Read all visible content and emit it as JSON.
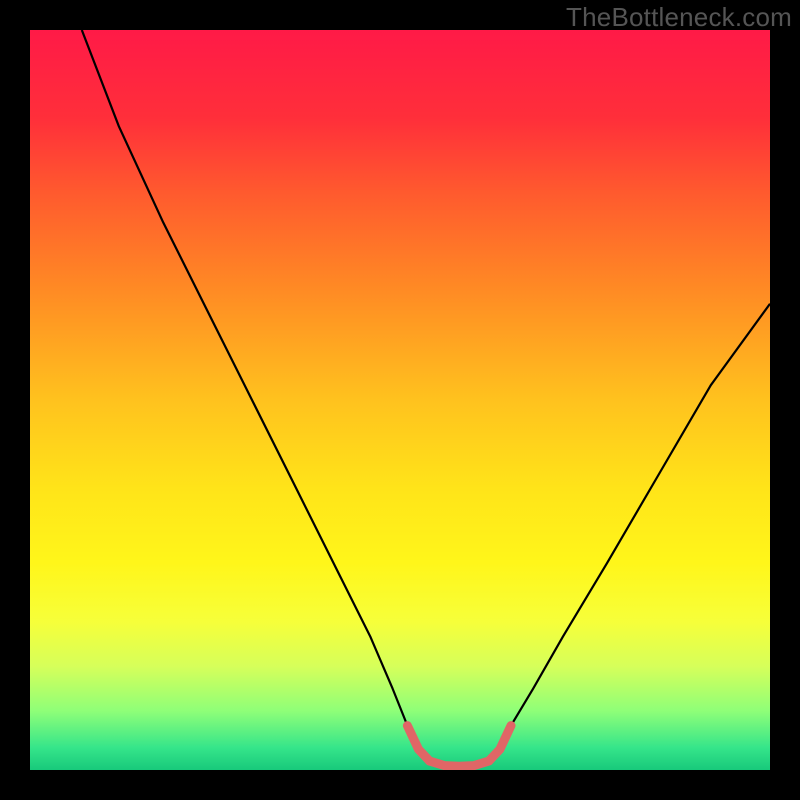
{
  "watermark": "TheBottleneck.com",
  "chart_data": {
    "type": "line",
    "title": "",
    "xlabel": "",
    "ylabel": "",
    "xlim": [
      0,
      100
    ],
    "ylim": [
      0,
      100
    ],
    "background_gradient": {
      "stops": [
        {
          "offset": 0.0,
          "color": "#ff1a47"
        },
        {
          "offset": 0.12,
          "color": "#ff2f3a"
        },
        {
          "offset": 0.22,
          "color": "#ff5a2e"
        },
        {
          "offset": 0.35,
          "color": "#ff8a24"
        },
        {
          "offset": 0.5,
          "color": "#ffc21e"
        },
        {
          "offset": 0.62,
          "color": "#ffe419"
        },
        {
          "offset": 0.72,
          "color": "#fff61a"
        },
        {
          "offset": 0.8,
          "color": "#f6ff3a"
        },
        {
          "offset": 0.86,
          "color": "#d6ff5a"
        },
        {
          "offset": 0.92,
          "color": "#8fff78"
        },
        {
          "offset": 0.97,
          "color": "#35e58a"
        },
        {
          "offset": 1.0,
          "color": "#18c97b"
        }
      ]
    },
    "curve": {
      "color": "#000000",
      "width": 2.2,
      "points": [
        {
          "x": 7.0,
          "y": 100.0
        },
        {
          "x": 12.0,
          "y": 87.0
        },
        {
          "x": 18.0,
          "y": 74.0
        },
        {
          "x": 24.0,
          "y": 62.0
        },
        {
          "x": 30.0,
          "y": 50.0
        },
        {
          "x": 36.0,
          "y": 38.0
        },
        {
          "x": 42.0,
          "y": 26.0
        },
        {
          "x": 46.0,
          "y": 18.0
        },
        {
          "x": 49.0,
          "y": 11.0
        },
        {
          "x": 51.0,
          "y": 6.0
        },
        {
          "x": 52.5,
          "y": 2.8
        },
        {
          "x": 54.0,
          "y": 1.2
        },
        {
          "x": 56.0,
          "y": 0.6
        },
        {
          "x": 58.0,
          "y": 0.5
        },
        {
          "x": 60.0,
          "y": 0.6
        },
        {
          "x": 62.0,
          "y": 1.2
        },
        {
          "x": 63.5,
          "y": 2.8
        },
        {
          "x": 65.0,
          "y": 6.0
        },
        {
          "x": 68.0,
          "y": 11.0
        },
        {
          "x": 72.0,
          "y": 18.0
        },
        {
          "x": 78.0,
          "y": 28.0
        },
        {
          "x": 85.0,
          "y": 40.0
        },
        {
          "x": 92.0,
          "y": 52.0
        },
        {
          "x": 100.0,
          "y": 63.0
        }
      ]
    },
    "highlight": {
      "color": "#e06666",
      "width": 9,
      "linecap": "round",
      "points": [
        {
          "x": 51.0,
          "y": 6.0
        },
        {
          "x": 52.5,
          "y": 2.8
        },
        {
          "x": 54.0,
          "y": 1.2
        },
        {
          "x": 56.0,
          "y": 0.6
        },
        {
          "x": 58.0,
          "y": 0.5
        },
        {
          "x": 60.0,
          "y": 0.6
        },
        {
          "x": 62.0,
          "y": 1.2
        },
        {
          "x": 63.5,
          "y": 2.8
        },
        {
          "x": 65.0,
          "y": 6.0
        }
      ]
    }
  }
}
